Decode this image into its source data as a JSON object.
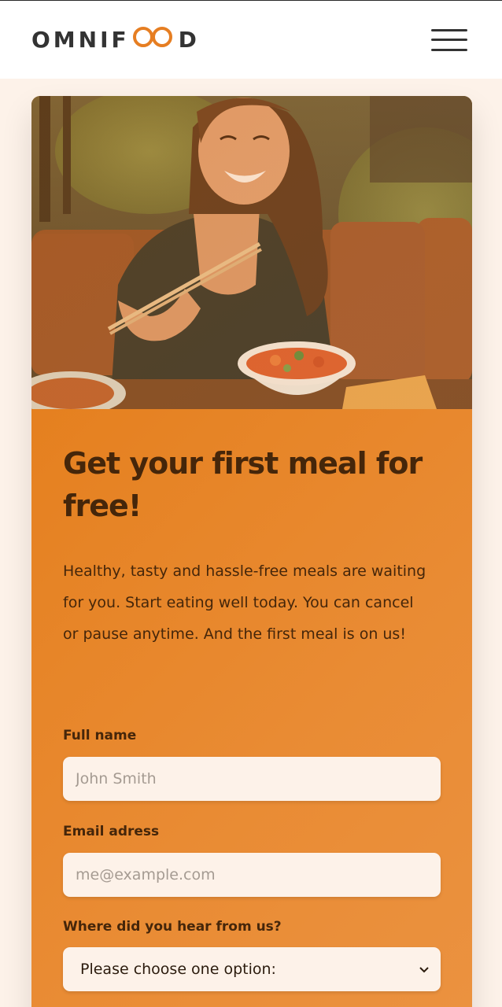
{
  "header": {
    "logo_start": "OMNIF",
    "logo_end": "D"
  },
  "colors": {
    "accent": "#e67e22",
    "text_dark": "#45260a",
    "input_bg": "#fdf2e9"
  },
  "cta": {
    "heading": "Get your first meal for free!",
    "description": "Healthy, tasty and hassle-free meals are waiting for you. Start eating well today. You can cancel or pause anytime. And the first meal is on us!",
    "form": {
      "name_label": "Full name",
      "name_placeholder": "John Smith",
      "email_label": "Email adress",
      "email_placeholder": "me@example.com",
      "source_label": "Where did you hear from us?",
      "source_selected": "Please choose one option:"
    }
  },
  "icons": {
    "menu": "menu-icon",
    "logo_mark": "infinity-icon",
    "select_caret": "chevron-down-icon"
  }
}
